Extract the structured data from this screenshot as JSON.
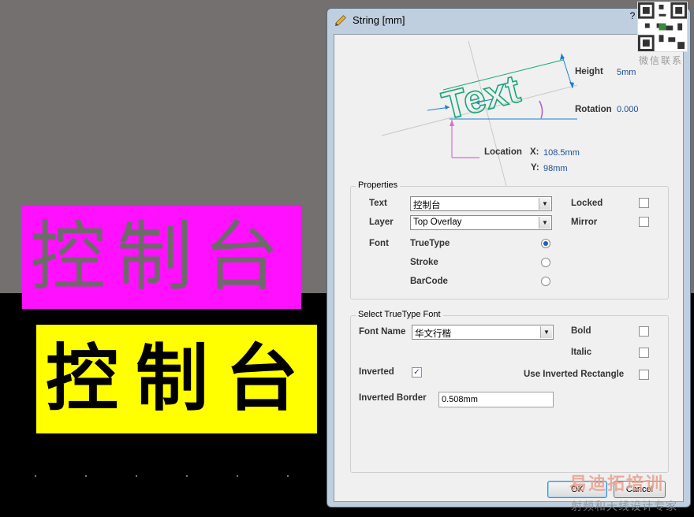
{
  "canvas": {
    "magenta_text": "控制台",
    "yellow_text": "控制台"
  },
  "dialog": {
    "title": "String  [mm]",
    "help": "?",
    "close": "✕",
    "diagram": {
      "sample_text": "Text",
      "height_label": "Height",
      "height_value": "5mm",
      "rotation_label": "Rotation",
      "rotation_value": "0.000",
      "location_label": "Location",
      "x_label": "X:",
      "x_value": "108.5mm",
      "y_label": "Y:",
      "y_value": "98mm"
    },
    "properties": {
      "title": "Properties",
      "text_label": "Text",
      "text_value": "控制台",
      "layer_label": "Layer",
      "layer_value": "Top Overlay",
      "locked_label": "Locked",
      "locked": false,
      "mirror_label": "Mirror",
      "mirror": false,
      "font_label": "Font",
      "font_options": [
        "TrueType",
        "Stroke",
        "BarCode"
      ],
      "font_selected": "TrueType"
    },
    "ttfont": {
      "title": "Select TrueType Font",
      "font_name_label": "Font Name",
      "font_name_value": "华文行楷",
      "bold_label": "Bold",
      "bold": false,
      "italic_label": "Italic",
      "italic": false,
      "inverted_label": "Inverted",
      "inverted": true,
      "use_inverted_rect_label": "Use Inverted Rectangle",
      "use_inverted_rect": false,
      "inverted_border_label": "Inverted Border",
      "inverted_border_value": "0.508mm"
    },
    "buttons": {
      "ok": "OK",
      "cancel": "Cancel"
    }
  },
  "overlays": {
    "qr_caption": "微信联系",
    "watermark_brand": "易迪拓培训",
    "watermark_sub": "射频和天线设计专家"
  },
  "colors": {
    "canvas_gray": "#747070",
    "magenta": "#ff10ff",
    "yellow": "#ffff00",
    "text_green": "#1aa67a",
    "value_blue": "#1a4f9a"
  }
}
